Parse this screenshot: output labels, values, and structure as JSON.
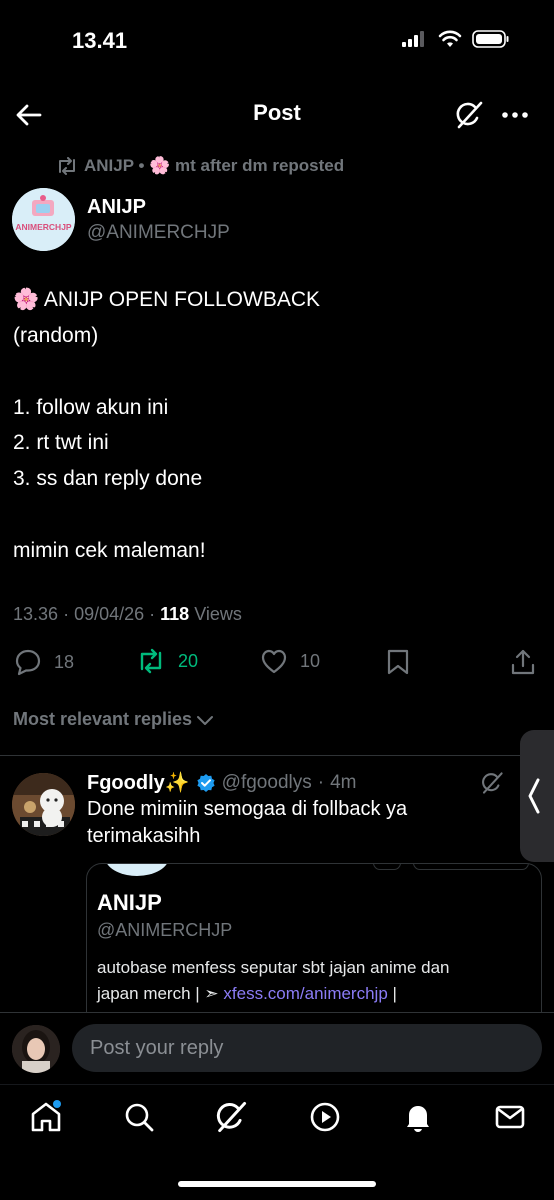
{
  "status_bar": {
    "time": "13.41"
  },
  "header": {
    "title": "Post"
  },
  "repost": {
    "text": "ANIJP • 🌸 mt after dm reposted"
  },
  "author": {
    "name": "ANIJP",
    "handle": "@ANIMERCHJP",
    "avatar_text": "ANIMERCHJP"
  },
  "tweet": {
    "lines": [
      "🌸 ANIJP OPEN FOLLOWBACK",
      "(random)",
      "1. follow akun ini",
      "2. rt twt ini",
      "3. ss dan reply done",
      "mimin cek maleman!"
    ],
    "time": "13.36",
    "date": "09/04/26",
    "views_count": "118",
    "views_label": "Views"
  },
  "actions": {
    "replies": "18",
    "reposts": "20",
    "likes": "10"
  },
  "replies_sort": "Most relevant replies",
  "reply": {
    "name": "Fgoodly✨",
    "handle": "@fgoodlys",
    "time": "4m",
    "lines": [
      "Done mimiin semogaa di follback ya",
      "terimakasihh"
    ],
    "quote": {
      "name": "ANIJP",
      "handle": "@ANIMERCHJP",
      "line1": "autobase menfess seputar sbt jajan anime dan",
      "line2_prefix": "japan merch | ➣ ",
      "line2_link": "xfess.com/animerchjp",
      "line2_suffix": " |"
    }
  },
  "composer": {
    "placeholder": "Post your reply"
  },
  "colors": {
    "accent": "#1d9bf0",
    "repost_green": "#00ba7c",
    "muted": "#71767b",
    "link": "#8b7cf6"
  },
  "nav": {
    "items": [
      "home-icon",
      "search-icon",
      "grok-icon",
      "video-icon",
      "notifications-icon",
      "messages-icon"
    ]
  }
}
